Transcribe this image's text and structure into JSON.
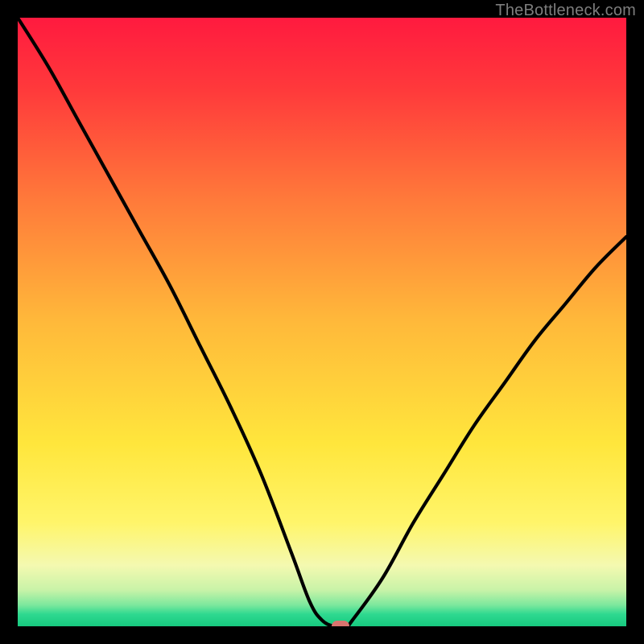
{
  "attribution": "TheBottleneck.com",
  "chart_data": {
    "type": "line",
    "title": "",
    "xlabel": "",
    "ylabel": "",
    "xlim": [
      0,
      100
    ],
    "ylim": [
      0,
      100
    ],
    "series": [
      {
        "name": "bottleneck-curve",
        "x": [
          0,
          5,
          10,
          15,
          20,
          25,
          30,
          35,
          40,
          45,
          48,
          50,
          52,
          54,
          55,
          60,
          65,
          70,
          75,
          80,
          85,
          90,
          95,
          100
        ],
        "y": [
          100,
          92,
          83,
          74,
          65,
          56,
          46,
          36,
          25,
          12,
          4,
          1,
          0,
          0,
          1,
          8,
          17,
          25,
          33,
          40,
          47,
          53,
          59,
          64
        ]
      }
    ],
    "marker": {
      "x": 53,
      "y": 0,
      "color": "#d9736e"
    },
    "gradient_stops": [
      {
        "pct": 0,
        "color": "#ff1a3f"
      },
      {
        "pct": 12,
        "color": "#ff3a3b"
      },
      {
        "pct": 30,
        "color": "#ff7a3a"
      },
      {
        "pct": 50,
        "color": "#ffb93a"
      },
      {
        "pct": 70,
        "color": "#ffe63c"
      },
      {
        "pct": 83,
        "color": "#fff56a"
      },
      {
        "pct": 90,
        "color": "#f4f9b0"
      },
      {
        "pct": 94,
        "color": "#c9f3a8"
      },
      {
        "pct": 96.5,
        "color": "#7de89d"
      },
      {
        "pct": 98,
        "color": "#2fd990"
      },
      {
        "pct": 100,
        "color": "#17c97f"
      }
    ]
  }
}
